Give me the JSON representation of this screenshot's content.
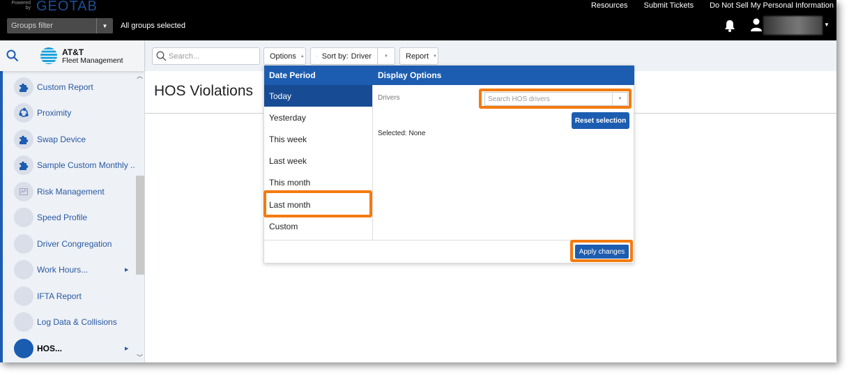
{
  "header": {
    "powered_by": "Powered by",
    "brand": "GEOTAB",
    "links": [
      "Resources",
      "Submit Tickets",
      "Do Not Sell My Personal Information"
    ],
    "groups_filter_placeholder": "Groups filter",
    "groups_status": "All groups selected",
    "icons": {
      "notifications": "bell-icon",
      "user": "user-icon"
    }
  },
  "sidebar": {
    "logo_name": "AT&T",
    "logo_subtitle": "Fleet Management",
    "items": [
      {
        "label": "Custom Report",
        "icon": "puzzle-icon",
        "has_submenu": false,
        "active": false
      },
      {
        "label": "Proximity",
        "icon": "proximity-icon",
        "has_submenu": false,
        "active": false
      },
      {
        "label": "Swap Device",
        "icon": "puzzle-icon",
        "has_submenu": false,
        "active": false
      },
      {
        "label": "Sample Custom Monthly ...",
        "icon": "puzzle-icon",
        "has_submenu": false,
        "active": false
      },
      {
        "label": "Risk Management",
        "icon": "chart-icon",
        "has_submenu": false,
        "active": false
      },
      {
        "label": "Speed Profile",
        "icon": "blank-icon",
        "has_submenu": false,
        "active": false
      },
      {
        "label": "Driver Congregation",
        "icon": "blank-icon",
        "has_submenu": false,
        "active": false
      },
      {
        "label": "Work Hours...",
        "icon": "blank-icon",
        "has_submenu": true,
        "active": false
      },
      {
        "label": "IFTA Report",
        "icon": "blank-icon",
        "has_submenu": false,
        "active": false
      },
      {
        "label": "Log Data & Collisions",
        "icon": "blank-icon",
        "has_submenu": false,
        "active": false
      },
      {
        "label": "HOS...",
        "icon": "blank-icon",
        "has_submenu": true,
        "active": true
      }
    ]
  },
  "toolbar": {
    "search_placeholder": "Search...",
    "options_label": "Options",
    "sort_label": "Sort by:",
    "sort_value": "Driver",
    "report_label": "Report"
  },
  "page": {
    "title": "HOS Violations"
  },
  "options_panel": {
    "date_period_header": "Date Period",
    "date_periods": [
      "Today",
      "Yesterday",
      "This week",
      "Last week",
      "This month",
      "Last month",
      "Custom"
    ],
    "selected_period": "Today",
    "highlighted_period": "Last month",
    "display_options_header": "Display Options",
    "drivers_label": "Drivers",
    "drivers_placeholder": "Search HOS drivers",
    "reset_label": "Reset selection",
    "selected_text": "Selected: None",
    "apply_label": "Apply changes"
  },
  "colors": {
    "brand_blue": "#1c5db1",
    "selected_blue": "#174c95",
    "highlight_orange": "#f47b0e",
    "header_black": "#000000"
  }
}
